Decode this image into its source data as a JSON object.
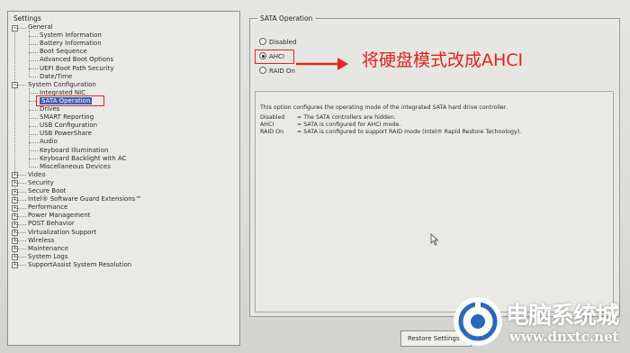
{
  "settings": {
    "title": "Settings",
    "items": [
      {
        "label": "General",
        "level": 0,
        "expanded": true
      },
      {
        "label": "System Information",
        "level": 1
      },
      {
        "label": "Battery Information",
        "level": 1
      },
      {
        "label": "Boot Sequence",
        "level": 1
      },
      {
        "label": "Advanced Boot Options",
        "level": 1
      },
      {
        "label": "UEFI Boot Path Security",
        "level": 1
      },
      {
        "label": "Date/Time",
        "level": 1
      },
      {
        "label": "System Configuration",
        "level": 0,
        "expanded": true
      },
      {
        "label": "Integrated NIC",
        "level": 1
      },
      {
        "label": "SATA Operation",
        "level": 1,
        "selected": true
      },
      {
        "label": "Drives",
        "level": 1
      },
      {
        "label": "SMART Reporting",
        "level": 1
      },
      {
        "label": "USB Configuration",
        "level": 1
      },
      {
        "label": "USB PowerShare",
        "level": 1
      },
      {
        "label": "Audio",
        "level": 1
      },
      {
        "label": "Keyboard Illumination",
        "level": 1
      },
      {
        "label": "Keyboard Backlight with AC",
        "level": 1
      },
      {
        "label": "Miscellaneous Devices",
        "level": 1
      },
      {
        "label": "Video",
        "level": 0
      },
      {
        "label": "Security",
        "level": 0
      },
      {
        "label": "Secure Boot",
        "level": 0
      },
      {
        "label": "Intel® Software Guard Extensions™",
        "level": 0
      },
      {
        "label": "Performance",
        "level": 0
      },
      {
        "label": "Power Management",
        "level": 0
      },
      {
        "label": "POST Behavior",
        "level": 0
      },
      {
        "label": "Virtualization Support",
        "level": 0
      },
      {
        "label": "Wireless",
        "level": 0
      },
      {
        "label": "Maintenance",
        "level": 0
      },
      {
        "label": "System Logs",
        "level": 0
      },
      {
        "label": "SupportAssist System Resolution",
        "level": 0
      }
    ]
  },
  "sata": {
    "title": "SATA Operation",
    "options": [
      {
        "label": "Disabled",
        "checked": false
      },
      {
        "label": "AHCI",
        "checked": true
      },
      {
        "label": "RAID On",
        "checked": false
      }
    ],
    "description": "This option configures the operating mode of the integrated SATA hard drive controller.",
    "details": [
      {
        "term": "Disabled",
        "text": "= The SATA controllers are hidden."
      },
      {
        "term": "AHCI",
        "text": "= SATA is configured for AHCI mode."
      },
      {
        "term": "RAID On",
        "text": "= SATA is configured to support RAID mode (Intel® Rapid Restore Technology)."
      }
    ]
  },
  "annotation": "将硬盘模式改成AHCI",
  "restore_button": "Restore Settings",
  "watermark": {
    "title": "电脑系统城",
    "url": "www.dnxtc.net"
  },
  "colors": {
    "highlight": "#e0261e",
    "selection": "#3a5db8"
  }
}
